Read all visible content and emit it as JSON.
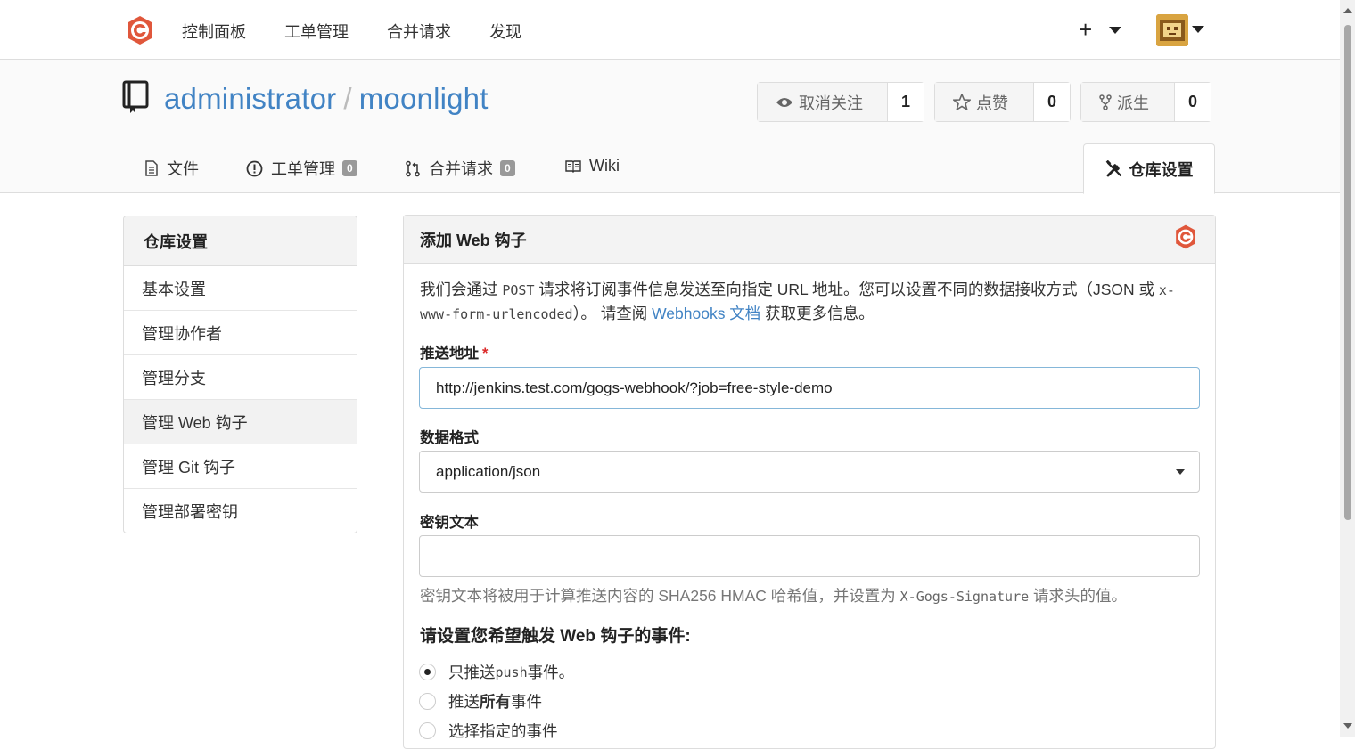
{
  "nav": {
    "items": [
      "控制面板",
      "工单管理",
      "合并请求",
      "发现"
    ],
    "plus": "+"
  },
  "repo": {
    "owner": "administrator",
    "separator": "/",
    "name": "moonlight"
  },
  "actions": {
    "watch_label": "取消关注",
    "watch_count": "1",
    "star_label": "点赞",
    "star_count": "0",
    "fork_label": "派生",
    "fork_count": "0"
  },
  "tabs": {
    "files": "文件",
    "issues": "工单管理",
    "issues_count": "0",
    "pulls": "合并请求",
    "pulls_count": "0",
    "wiki": "Wiki",
    "settings": "仓库设置"
  },
  "sidebar": {
    "title": "仓库设置",
    "items": [
      "基本设置",
      "管理协作者",
      "管理分支",
      "管理 Web 钩子",
      "管理 Git 钩子",
      "管理部署密钥"
    ]
  },
  "panel": {
    "title": "添加 Web 钩子",
    "desc_1": "我们会通过 ",
    "desc_post": "POST",
    "desc_2": " 请求将订阅事件信息发送至向指定 URL 地址。您可以设置不同的数据接收方式（JSON 或 ",
    "desc_mono": "x-www-form-urlencoded",
    "desc_3": "）。 请查阅 ",
    "desc_link": "Webhooks 文档",
    "desc_4": " 获取更多信息。",
    "url_label": "推送地址",
    "required_mark": "*",
    "url_value": "http://jenkins.test.com/gogs-webhook/?job=free-style-demo",
    "content_type_label": "数据格式",
    "content_type_value": "application/json",
    "secret_label": "密钥文本",
    "secret_value": "",
    "help_1": "密钥文本将被用于计算推送内容的 SHA256 HMAC 哈希值，并设置为 ",
    "help_mono": "X-Gogs-Signature",
    "help_2": " 请求头的值。",
    "events_title": "请设置您希望触发 Web 钩子的事件:",
    "opt_push_1": "只推送 ",
    "opt_push_mono": "push",
    "opt_push_2": " 事件。",
    "opt_all_1": "推送 ",
    "opt_all_bold": "所有",
    "opt_all_2": " 事件",
    "opt_choose": "选择指定的事件"
  },
  "colors": {
    "link": "#4183c4",
    "brand": "#e0573b",
    "required": "#db2828"
  }
}
